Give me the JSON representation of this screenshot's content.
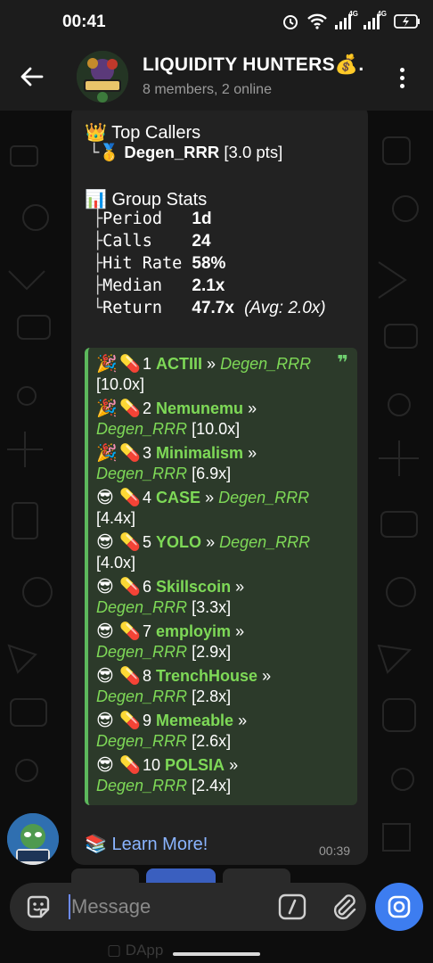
{
  "status_bar": {
    "time": "00:41",
    "net1": "4G",
    "net2": "4G"
  },
  "header": {
    "title": "LIQUIDITY HUNTERS💰.",
    "subtitle": "8 members, 2 online"
  },
  "message": {
    "top_callers": {
      "title": "Top Callers",
      "title_emoji": "👑",
      "entries": [
        {
          "medal": "🥇",
          "name": "Degen_RRR",
          "pts": "[3.0 pts]"
        }
      ]
    },
    "group_stats": {
      "title": "Group Stats",
      "title_emoji": "📊",
      "rows": [
        {
          "tree": "├",
          "label": "Period   ",
          "value": "1d",
          "extra": ""
        },
        {
          "tree": "├",
          "label": "Calls    ",
          "value": "24",
          "extra": ""
        },
        {
          "tree": "├",
          "label": "Hit Rate ",
          "value": "58%",
          "extra": ""
        },
        {
          "tree": "├",
          "label": "Median   ",
          "value": "2.1x",
          "extra": ""
        },
        {
          "tree": "└",
          "label": "Return   ",
          "value": "47.7x",
          "extra": "(Avg: 2.0x)"
        }
      ]
    },
    "quote_mark": "❞",
    "leaderboard_lines": [
      {
        "emoji": "🎉",
        "pill": "💊",
        "rank": "1",
        "coin": "ACTIII",
        "sep": "»",
        "caller": "Degen_RRR",
        "mult": "",
        "caller2": "",
        "mult2": "[10.0x]"
      },
      {
        "emoji": "🎉",
        "pill": "💊",
        "rank": "2",
        "coin": "Nemunemu",
        "sep": "»",
        "caller": "",
        "mult": "",
        "caller2": "Degen_RRR",
        "mult2": "[10.0x]"
      },
      {
        "emoji": "🎉",
        "pill": "💊",
        "rank": "3",
        "coin": "Minimalism",
        "sep": "»",
        "caller": "",
        "mult": "",
        "caller2": "Degen_RRR",
        "mult2": "[6.9x]"
      },
      {
        "emoji": "😎",
        "pill": "💊",
        "rank": "4",
        "coin": "CASE",
        "sep": "»",
        "caller": "Degen_RRR",
        "mult": "",
        "caller2": "",
        "mult2": "[4.4x]"
      },
      {
        "emoji": "😎",
        "pill": "💊",
        "rank": "5",
        "coin": "YOLO",
        "sep": "»",
        "caller": "Degen_RRR",
        "mult": "",
        "caller2": "",
        "mult2": "[4.0x]"
      },
      {
        "emoji": "😎",
        "pill": "💊",
        "rank": "6",
        "coin": "Skillscoin",
        "sep": "»",
        "caller": "",
        "mult": "",
        "caller2": "Degen_RRR",
        "mult2": "[3.3x]"
      },
      {
        "emoji": "😎",
        "pill": "💊",
        "rank": "7",
        "coin": "employim",
        "sep": "»",
        "caller": "",
        "mult": "",
        "caller2": "Degen_RRR",
        "mult2": "[2.9x]"
      },
      {
        "emoji": "😎",
        "pill": "💊",
        "rank": "8",
        "coin": "TrenchHouse",
        "sep": "»",
        "caller": "",
        "mult": "",
        "caller2": "Degen_RRR",
        "mult2": "[2.8x]"
      },
      {
        "emoji": "😎",
        "pill": "💊",
        "rank": "9",
        "coin": "Memeable",
        "sep": "»",
        "caller": "",
        "mult": "",
        "caller2": "Degen_RRR",
        "mult2": "[2.6x]"
      },
      {
        "emoji": "😎",
        "pill": "💊",
        "rank": "10",
        "coin": "POLSIA",
        "sep": "»",
        "caller": "",
        "mult": "",
        "caller2": "Degen_RRR",
        "mult2": "[2.4x]"
      }
    ],
    "learn_more": {
      "emoji": "📚",
      "label": "Learn More!"
    },
    "time": "00:39"
  },
  "composer": {
    "placeholder": "Message",
    "command_glyph": "/",
    "nav_hint": "DApp"
  },
  "colors": {
    "accent": "#3d7df0",
    "quote_bg": "#2c3a2a",
    "quote_border": "#5cb85c",
    "coin_green": "#7ed957",
    "link_blue": "#8ab4ff",
    "bubble": "#222222"
  },
  "icons": {
    "back": "arrow-left-icon",
    "menu": "more-vertical-icon",
    "emoji": "sticker-icon",
    "command": "slash-command-icon",
    "attach": "paperclip-icon",
    "camera": "camera-icon"
  }
}
